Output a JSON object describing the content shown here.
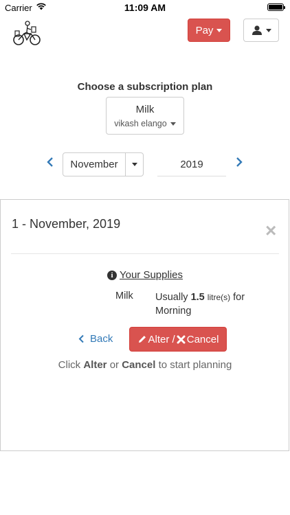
{
  "status_bar": {
    "carrier": "Carrier",
    "time": "11:09 AM"
  },
  "header": {
    "logo_icon": "bicycle-delivery-logo",
    "pay_label": "Pay",
    "user_icon": "user-icon",
    "accent_danger": "#d9534f"
  },
  "plan": {
    "heading": "Choose a subscription plan",
    "selected_plan": "Milk",
    "selected_user": "vikash elango"
  },
  "date_nav": {
    "month": "November",
    "year": "2019"
  },
  "day_panel": {
    "title": "1 - November, 2019",
    "close_symbol": "×",
    "supplies_heading": "Your Supplies",
    "supplies": [
      {
        "item": "Milk",
        "prefix": "Usually",
        "quantity": "1.5",
        "unit": "litre(s)",
        "suffix": "for",
        "slot": "Morning"
      }
    ],
    "back_label": "Back",
    "alter_label": "Alter /",
    "cancel_label": "Cancel",
    "hint": {
      "pre": "Click",
      "alter": "Alter",
      "or": "or",
      "cancel": "Cancel",
      "post": "to start planning"
    }
  },
  "colors": {
    "link": "#337ab7",
    "danger": "#d9534f"
  }
}
